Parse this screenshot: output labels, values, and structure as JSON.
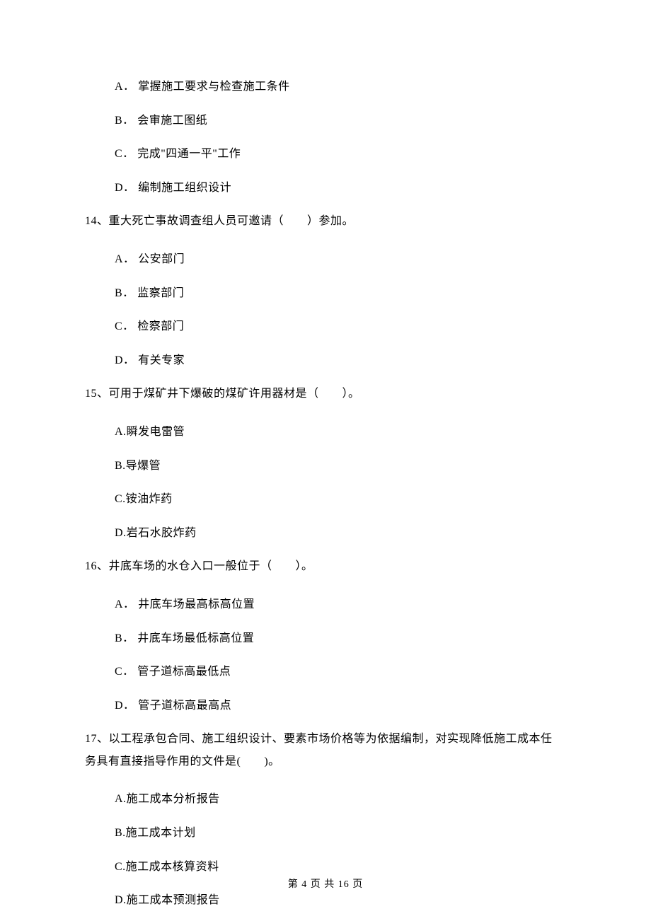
{
  "prevQuestion": {
    "options": [
      {
        "label": "A．",
        "text": "掌握施工要求与检查施工条件"
      },
      {
        "label": "B．",
        "text": "会审施工图纸"
      },
      {
        "label": "C．",
        "text": "完成\"四通一平\"工作"
      },
      {
        "label": "D．",
        "text": "编制施工组织设计"
      }
    ]
  },
  "q14": {
    "stem": "14、重大死亡事故调查组人员可邀请（　　）参加。",
    "options": [
      {
        "label": "A．",
        "text": "公安部门"
      },
      {
        "label": "B．",
        "text": "监察部门"
      },
      {
        "label": "C．",
        "text": "检察部门"
      },
      {
        "label": "D．",
        "text": "有关专家"
      }
    ]
  },
  "q15": {
    "stem": "15、可用于煤矿井下爆破的煤矿许用器材是（　　）。",
    "options": [
      {
        "label": "A.",
        "text": "瞬发电雷管"
      },
      {
        "label": "B.",
        "text": "导爆管"
      },
      {
        "label": "C.",
        "text": "铵油炸药"
      },
      {
        "label": "D.",
        "text": "岩石水胶炸药"
      }
    ]
  },
  "q16": {
    "stem": "16、井底车场的水仓入口一般位于（　　）。",
    "options": [
      {
        "label": "A．",
        "text": "井底车场最高标高位置"
      },
      {
        "label": "B．",
        "text": "井底车场最低标高位置"
      },
      {
        "label": "C．",
        "text": "管子道标高最低点"
      },
      {
        "label": "D．",
        "text": "管子道标高最高点"
      }
    ]
  },
  "q17": {
    "stem_line1": "17、以工程承包合同、施工组织设计、要素市场价格等为依据编制，对实现降低施工成本任",
    "stem_line2": "务具有直接指导作用的文件是(　　)。",
    "options": [
      {
        "label": "A.",
        "text": "施工成本分析报告"
      },
      {
        "label": "B.",
        "text": "施工成本计划"
      },
      {
        "label": "C.",
        "text": "施工成本核算资料"
      },
      {
        "label": "D.",
        "text": "施工成本预测报告"
      }
    ]
  },
  "footer": "第 4 页 共 16 页"
}
